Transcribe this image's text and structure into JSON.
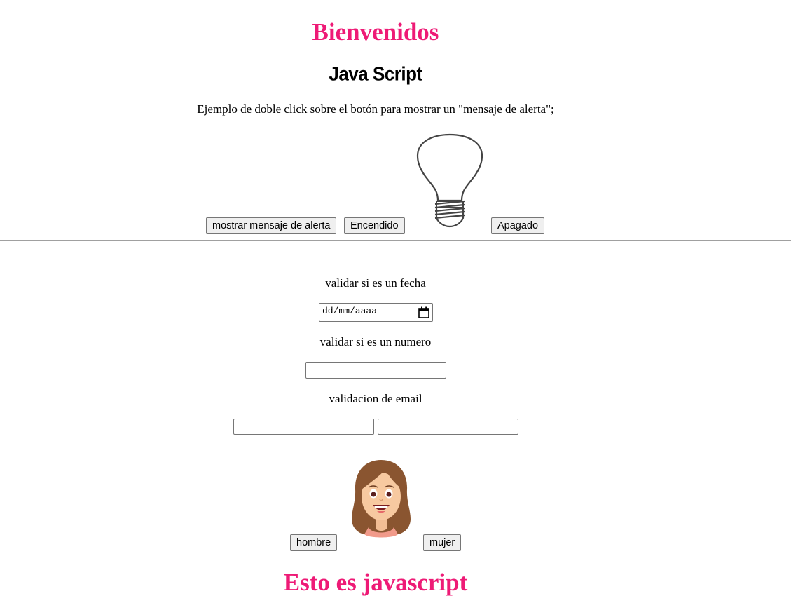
{
  "header": {
    "title": "Bienvenidos",
    "subtitle": "Java Script",
    "description": "Ejemplo de doble click sobre el botón para mostrar un \"mensaje de alerta\";"
  },
  "bulb_section": {
    "alert_button": "mostrar mensaje de alerta",
    "on_button": "Encendido",
    "off_button": "Apagado",
    "bulb_state": "off",
    "bulb_icon": "lightbulb-icon"
  },
  "form": {
    "date_label": "validar si es un fecha",
    "date_placeholder": "dd/mm/aaaa",
    "number_label": "validar si es un numero",
    "number_value": "",
    "email_label": "validacion de email",
    "email_value_1": "",
    "email_value_2": ""
  },
  "avatar_section": {
    "man_button": "hombre",
    "woman_button": "mujer",
    "avatar_icon": "woman-avatar-icon"
  },
  "footer": {
    "title": "Esto es javascript"
  },
  "colors": {
    "title": "#ee1a76",
    "hair": "#8a5530",
    "skin": "#f7c9a0"
  }
}
